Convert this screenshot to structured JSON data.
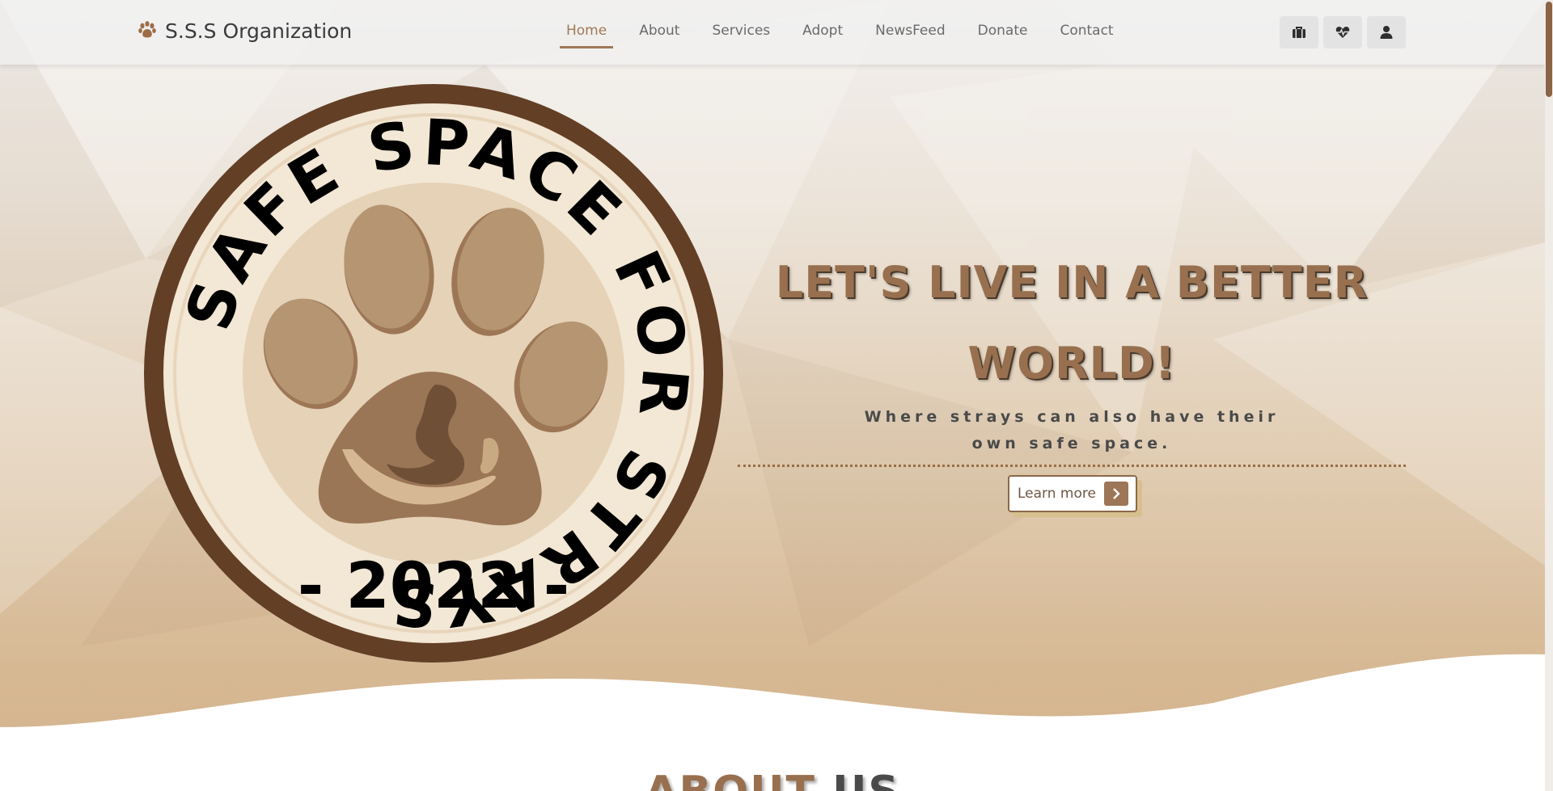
{
  "brand": {
    "name": "S.S.S Organization",
    "icon": "paw-icon"
  },
  "nav": {
    "items": [
      {
        "label": "Home",
        "active": true
      },
      {
        "label": "About",
        "active": false
      },
      {
        "label": "Services",
        "active": false
      },
      {
        "label": "Adopt",
        "active": false
      },
      {
        "label": "NewsFeed",
        "active": false
      },
      {
        "label": "Donate",
        "active": false
      },
      {
        "label": "Contact",
        "active": false
      }
    ],
    "icons": [
      "briefcase-icon",
      "heartbeat-icon",
      "user-icon"
    ]
  },
  "logo": {
    "ring_text": "SAFE SPACE FOR STRAYS",
    "year": "- 2022 -"
  },
  "hero": {
    "headline_line1": "LET'S LIVE IN A BETTER",
    "headline_line2": "WORLD!",
    "subline_line1": "Where strays can also have their",
    "subline_line2": "own safe space.",
    "button_label": "Learn more"
  },
  "about": {
    "title_part1": "ABOUT",
    "title_part2": "US"
  },
  "colors": {
    "accent": "#98704f",
    "dark_brown": "#633f26",
    "cream": "#f2e6d3",
    "tan": "#d3b38c"
  }
}
